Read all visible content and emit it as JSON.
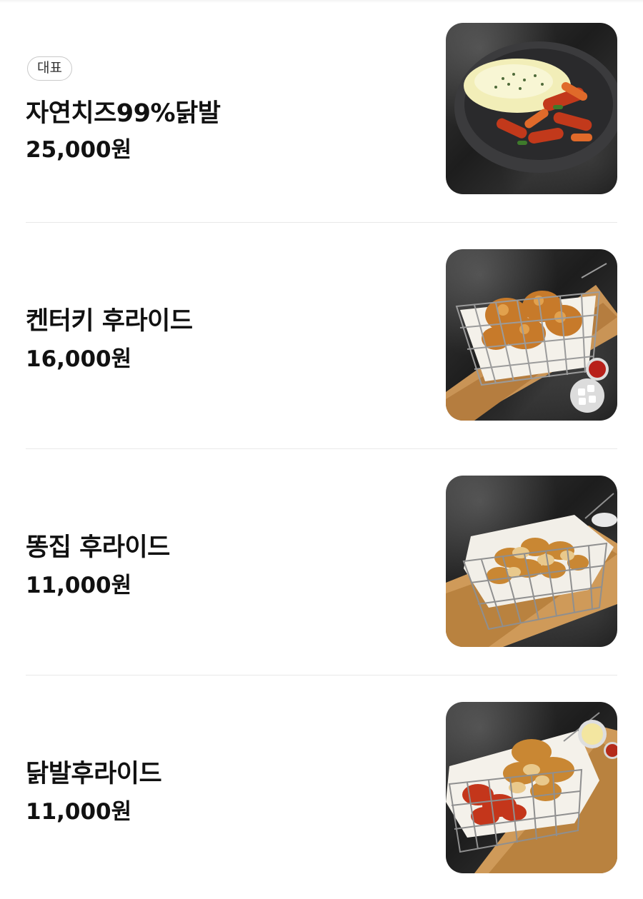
{
  "menu": {
    "items": [
      {
        "badge": "대표",
        "name": "자연치즈99%닭발",
        "price": "25,000원",
        "image_icon": "cheese-spicy-chicken-feet-dish-icon"
      },
      {
        "name": "켄터키 후라이드",
        "price": "16,000원",
        "image_icon": "fried-chicken-basket-icon"
      },
      {
        "name": "똥집 후라이드",
        "price": "11,000원",
        "image_icon": "fried-gizzard-basket-icon"
      },
      {
        "name": "닭발후라이드",
        "price": "11,000원",
        "image_icon": "fried-chicken-feet-basket-icon"
      }
    ]
  }
}
